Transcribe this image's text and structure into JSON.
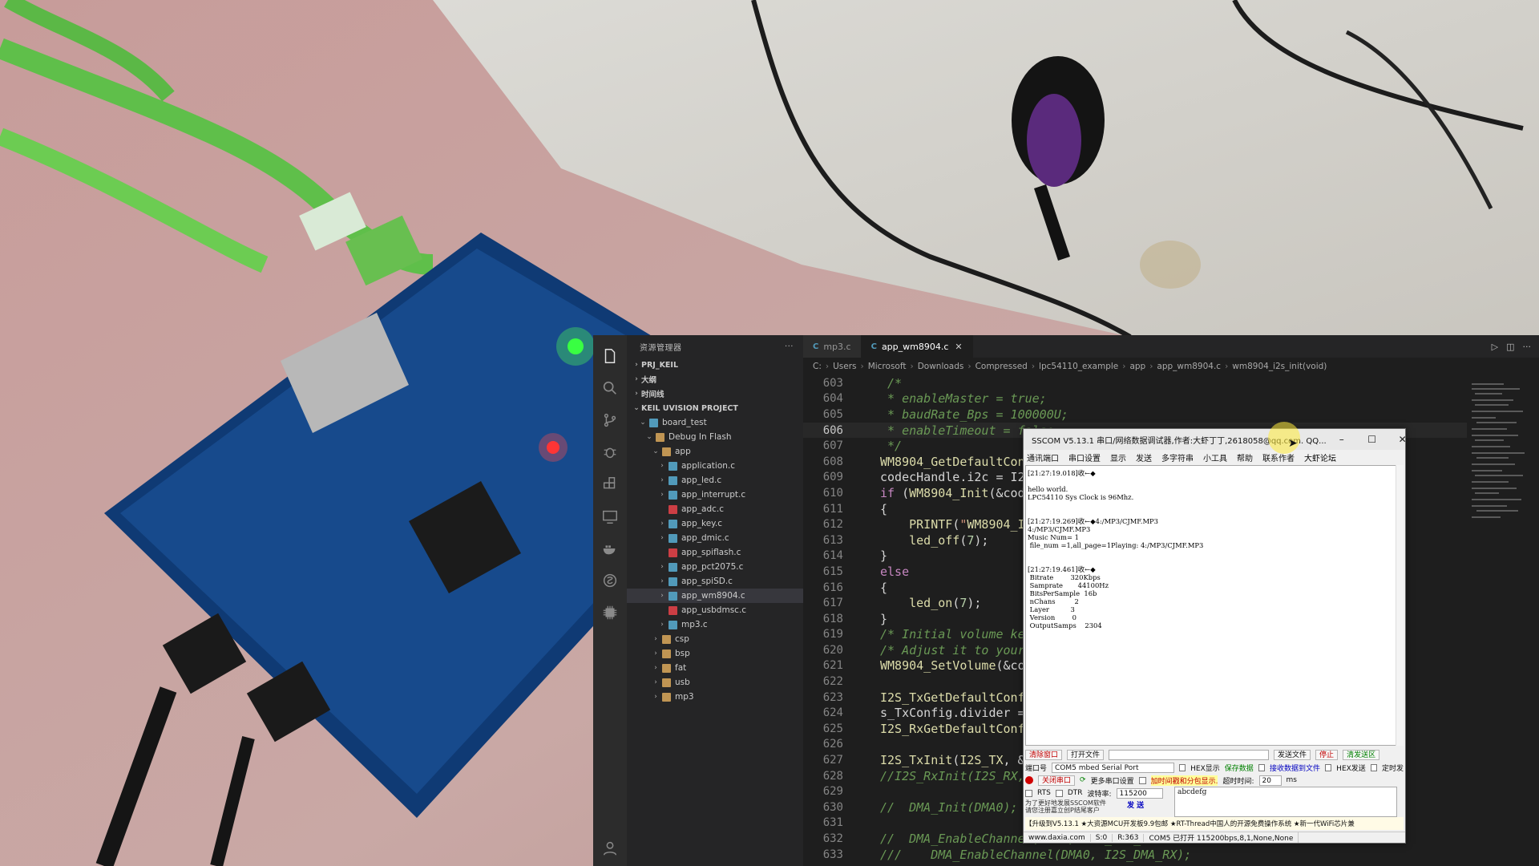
{
  "explorer": {
    "header": "资源管理器",
    "sections": [
      "PRJ_KEIL",
      "大纲",
      "时间线",
      "KEIL UVISION PROJECT"
    ],
    "project": "board_test",
    "target": "Debug In Flash",
    "app_folder": "app",
    "app_files": [
      "application.c",
      "app_led.c",
      "app_interrupt.c",
      "app_adc.c",
      "app_key.c",
      "app_dmic.c",
      "app_spiflash.c",
      "app_pct2075.c",
      "app_spiSD.c",
      "app_wm8904.c",
      "app_usbdmsc.c",
      "mp3.c"
    ],
    "folders": [
      "csp",
      "bsp",
      "fat",
      "usb",
      "mp3"
    ]
  },
  "tabs": [
    "mp3.c",
    "app_wm8904.c"
  ],
  "breadcrumb": [
    "C:",
    "Users",
    "Microsoft",
    "Downloads",
    "Compressed",
    "lpc54110_example",
    "app",
    "app_wm8904.c",
    "wm8904_i2s_init(void)"
  ],
  "code": {
    "line_numbers": [
      "603",
      "604",
      "605",
      "606",
      "607",
      "608",
      "609",
      "610",
      "611",
      "612",
      "613",
      "614",
      "615",
      "616",
      "617",
      "618",
      "619",
      "620",
      "621",
      "622",
      "623",
      "624",
      "625",
      "626",
      "627",
      "628",
      "629",
      "630",
      "631",
      "632",
      "633"
    ],
    "current_line": "606",
    "lines": [
      " /*",
      " * enableMaster = true;",
      " * baudRate_Bps = 100000U;",
      " * enableTimeout = false",
      " */",
      "WM8904_GetDefaultConfig",
      "codecHandle.i2c = I2C4;",
      "if (WM8904_Init(&codecHa",
      "{",
      "    PRINTF(\"WM8904_Init",
      "    led_off(7);",
      "}",
      "else",
      "{",
      "    led_on(7);",
      "}",
      "/* Initial volume kept",
      "/* Adjust it to your nee",
      "WM8904_SetVolume(&codecH",
      "",
      "I2S_TxGetDefaultConfig(&",
      "s_TxConfig.divider = CLO",
      "I2S_RxGetDefaultConfig(&",
      "",
      "I2S_TxInit(I2S_TX, &s_T",
      "//I2S_RxInit(I2S_RX, &s",
      "",
      "//  DMA_Init(DMA0);",
      "",
      "//  DMA_EnableChannel(DMA0, I2S_DMA_TX",
      "///    DMA_EnableChannel(DMA0, I2S_DMA_RX);"
    ]
  },
  "sscom": {
    "title": "SSCOM V5.13.1 串口/网络数据调试器,作者:大虾丁丁,2618058@qq.com. QQ...",
    "menu": [
      "通讯端口",
      "串口设置",
      "显示",
      "发送",
      "多字符串",
      "小工具",
      "帮助",
      "联系作者",
      "大虾论坛"
    ],
    "output": "[21:27:19.018]收←◆\n\nhello world.\nLPC54110 Sys Clock is 96Mhz.\n\n\n[21:27:19.269]收←◆4:/MP3/CJMF.MP3\n4:/MP3/CJMF.MP3\nMusic Num= 1\n file_num =1,all_page=1Playing: 4:/MP3/CJMF.MP3\n\n\n[21:27:19.461]收←◆\n Bitrate        320Kbps\n Samprate       44100Hz\n BitsPerSample  16b\n nChans         2\n Layer          3\n Version        0\n OutputSamps    2304",
    "btn_clear": "清除窗口",
    "btn_open_file": "打开文件",
    "btn_send_file": "发送文件",
    "btn_stop": "停止",
    "btn_clear_send": "清发送区",
    "label_port": "端口号",
    "port_value": "COM5 mbed Serial Port",
    "hex_show": "HEX显示",
    "save_data": "保存数据",
    "recv_to_file": "接收数据到文件",
    "hex_send": "HEX发送",
    "timed_send": "定时发",
    "btn_close_port": "关闭串口",
    "more_port_settings": "更多串口设置",
    "timestamp_label": "加时间戳和分包显示.",
    "timeout_label": "超时时间:",
    "timeout_value": "20",
    "timeout_unit": "ms",
    "rts": "RTS",
    "dtr": "DTR",
    "baud_label": "波特率:",
    "baud_value": "115200",
    "send_text": "abcdefg",
    "promo": "为了更好地发展SSCOM软件\n请您注册嘉立创P结尾客户",
    "btn_send": "发 送",
    "ticker": "【升级到V5.13.1 ★大资源MCU开发板9.9包邮 ★RT-Thread中国人的开源免费操作系统 ★新一代WiFi芯片兼",
    "status": [
      "www.daxia.com",
      "S:0",
      "R:363",
      "COM5 已打开  115200bps,8,1,None,None"
    ]
  }
}
